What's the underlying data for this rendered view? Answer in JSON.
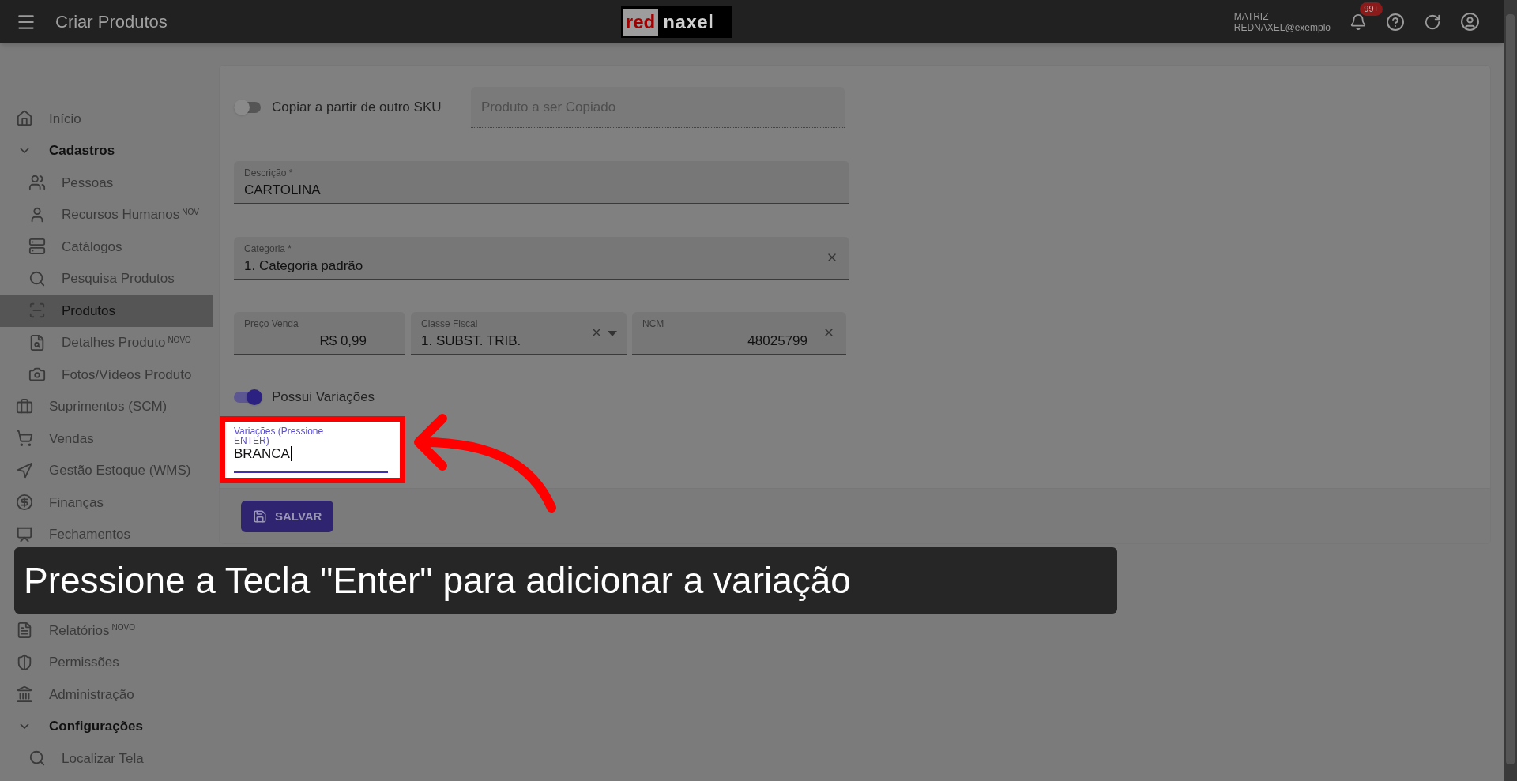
{
  "topbar": {
    "title": "Criar Produtos",
    "logo": {
      "part_1": "red",
      "part_2": "naxel"
    },
    "account": {
      "line_1": "MATRIZ",
      "line_2": "REDNAXEL@exemplo"
    },
    "notifications_badge": "99+"
  },
  "sidebar": {
    "items": [
      {
        "label": "Início",
        "selected": false
      },
      {
        "label": "Cadastros",
        "expanded": true,
        "children": [
          {
            "label": "Pessoas",
            "selected": false
          },
          {
            "label": "Recursos Humanos",
            "badge": "NOV",
            "selected": false
          },
          {
            "label": "Catálogos",
            "selected": false
          },
          {
            "label": "Pesquisa Produtos",
            "selected": false
          },
          {
            "label": "Produtos",
            "selected": true
          },
          {
            "label": "Detalhes Produto",
            "badge": "NOVO",
            "selected": false
          },
          {
            "label": "Fotos/Vídeos Produto",
            "selected": false
          }
        ]
      },
      {
        "label": "Suprimentos (SCM)",
        "selected": false
      },
      {
        "label": "Vendas",
        "selected": false
      },
      {
        "label": "Gestão Estoque (WMS)",
        "selected": false
      },
      {
        "label": "Finanças",
        "selected": false
      },
      {
        "label": "Fechamentos",
        "selected": false
      },
      {
        "kind": "covered"
      },
      {
        "kind": "covered"
      },
      {
        "label": "Relatórios",
        "badge": "NOVO",
        "selected": false
      },
      {
        "label": "Permissões",
        "selected": false
      },
      {
        "label": "Administração",
        "selected": false
      },
      {
        "label": "Configurações",
        "expanded": true,
        "children": [
          {
            "label": "Localizar Tela",
            "selected": false
          }
        ]
      }
    ]
  },
  "form": {
    "copy_toggle": {
      "label": "Copiar a partir de outro SKU",
      "on": false
    },
    "copy_field": {
      "placeholder": "Produto a ser Copiado"
    },
    "descricao": {
      "label": "Descrição *",
      "value": "CARTOLINA"
    },
    "categoria": {
      "label": "Categoria *",
      "value": "1. Categoria padrão"
    },
    "preco": {
      "label": "Preço Venda",
      "value": "R$ 0,99"
    },
    "classe_fiscal": {
      "label": "Classe Fiscal",
      "value": "1. SUBST. TRIB."
    },
    "ncm": {
      "label": "NCM",
      "value": "48025799"
    },
    "variations_toggle": {
      "label": "Possui Variações",
      "on": true
    },
    "variations_field": {
      "label": "Variações (Pressione ENTER)",
      "value": "BRANCA"
    },
    "save_button": "SALVAR"
  },
  "caption": "Pressione a Tecla \"Enter\" para adicionar a variação"
}
